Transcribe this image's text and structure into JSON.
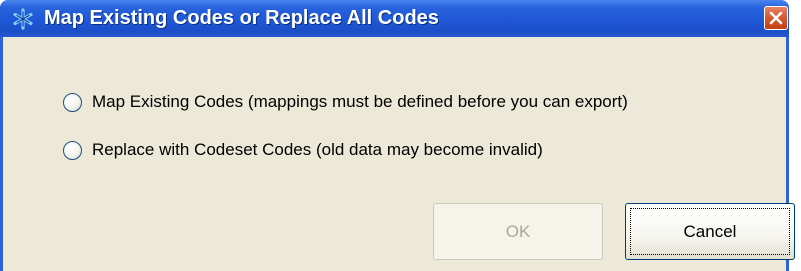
{
  "window": {
    "title": "Map Existing Codes or Replace All Codes",
    "title_icon": "asterisk-app-icon",
    "close_icon": "close-icon"
  },
  "options": [
    {
      "label": "Map Existing Codes (mappings must be defined before you can export)",
      "selected": false
    },
    {
      "label": "Replace with Codeset Codes (old data may become invalid)",
      "selected": false
    }
  ],
  "buttons": {
    "ok_label": "OK",
    "ok_enabled": false,
    "cancel_label": "Cancel"
  },
  "colors": {
    "titlebar": "#1f57d6",
    "client_bg": "#ece9d8",
    "close_button": "#d5582f"
  }
}
